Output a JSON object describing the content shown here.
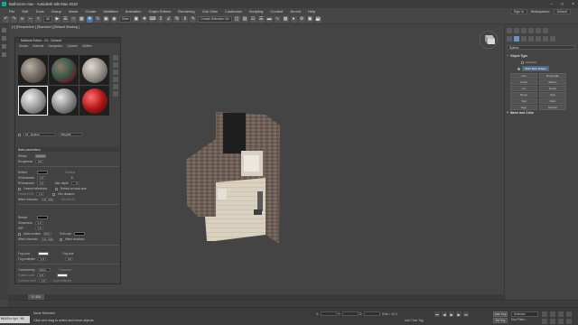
{
  "window": {
    "title": "Bathroom.max - Autodesk 3ds Max 2018"
  },
  "menu": {
    "items": [
      "File",
      "Edit",
      "Tools",
      "Group",
      "Views",
      "Create",
      "Modifiers",
      "Animation",
      "Graph Editors",
      "Rendering",
      "Civil View",
      "Customize",
      "Scripting",
      "Content",
      "Arnold",
      "Help"
    ],
    "sign_in": "Sign In",
    "workspaces_label": "Workspaces:",
    "workspace_value": "Default"
  },
  "toolbar": {
    "filter": "All",
    "view": "View",
    "selection_set": "Create Selection Se"
  },
  "viewport": {
    "label": "[+] [Perspective ] [Standard ] [Default Shading ]"
  },
  "material_editor": {
    "title": "Material Editor - 01 - Default",
    "menu": [
      "Modes",
      "Material",
      "Navigation",
      "Options",
      "Utilities"
    ],
    "material_name": "01 - Default",
    "material_type": "VRayMtl",
    "rollout": "Basic parameters",
    "rows": {
      "diffuse": "Diffuse",
      "roughness": "Roughness",
      "roughness_val": "0.0",
      "reflect": "Reflect",
      "hglossiness": "HGlossiness",
      "hgloss_val": "1.0",
      "rglossiness": "RGlossiness",
      "rgloss_val": "1.0",
      "fresnel": "Fresnel reflections",
      "fresnel_ior": "Fresnel IOR",
      "fresnel_ior_val": "1.6",
      "affect_channels": "Affect channels",
      "affect_val": "Col. only",
      "subdivs": "Subdivs",
      "subdivs_val": "8",
      "max_depth": "Max depth",
      "max_depth_val": "5",
      "reflect_back": "Reflect on back side",
      "dim_distance": "Dim distance",
      "dim_falloff": "Dim fall off",
      "refract": "Refract",
      "glossiness": "Glossiness",
      "gloss_val": "1.0",
      "ior": "IOR",
      "ior_val": "1.6",
      "abbe": "Abbe number",
      "abbe_val": "50.0",
      "exit_color": "Exit color",
      "affect_shadows": "Affect shadows",
      "fog_color": "Fog color",
      "fog_bias": "Fog bias",
      "fog_mult": "Fog multiplier",
      "fog_mult_val": "1.0",
      "fog_bias_val": "0.0",
      "translucency": "Translucency",
      "transl_val": "None",
      "scatter": "Scatter coeff",
      "scatter_val": "0.0",
      "fwd_bck": "Fwd/bck coeff",
      "fwd_val": "1.0",
      "thickness": "Thickness",
      "light_mult": "Light multiplier"
    }
  },
  "command_panel": {
    "dropdown": "Splines",
    "object_type": "Object Type",
    "auto_grid": "AutoGrid",
    "buttons": [
      "Line",
      "Rectangle",
      "Circle",
      "Ellipse",
      "Arc",
      "Donut",
      "NGon",
      "Star",
      "Text",
      "Helix",
      "Egg",
      "Section"
    ],
    "start_new_shape": "Start New Shape",
    "name_and_color": "Name and Color"
  },
  "time": {
    "slider": "0 / 100"
  },
  "status": {
    "maxscript": "MAXScript Mi",
    "line1": "None Selected",
    "line2": "Click and drag to select and move objects",
    "x": "X:",
    "y": "Y:",
    "z": "Z:",
    "grid": "Grid = 10.0",
    "add_time_tag": "Add Time Tag",
    "auto_key": "Auto Key",
    "set_key": "Set Key",
    "selected": "Selected",
    "key_filters": "Key Filters..."
  }
}
